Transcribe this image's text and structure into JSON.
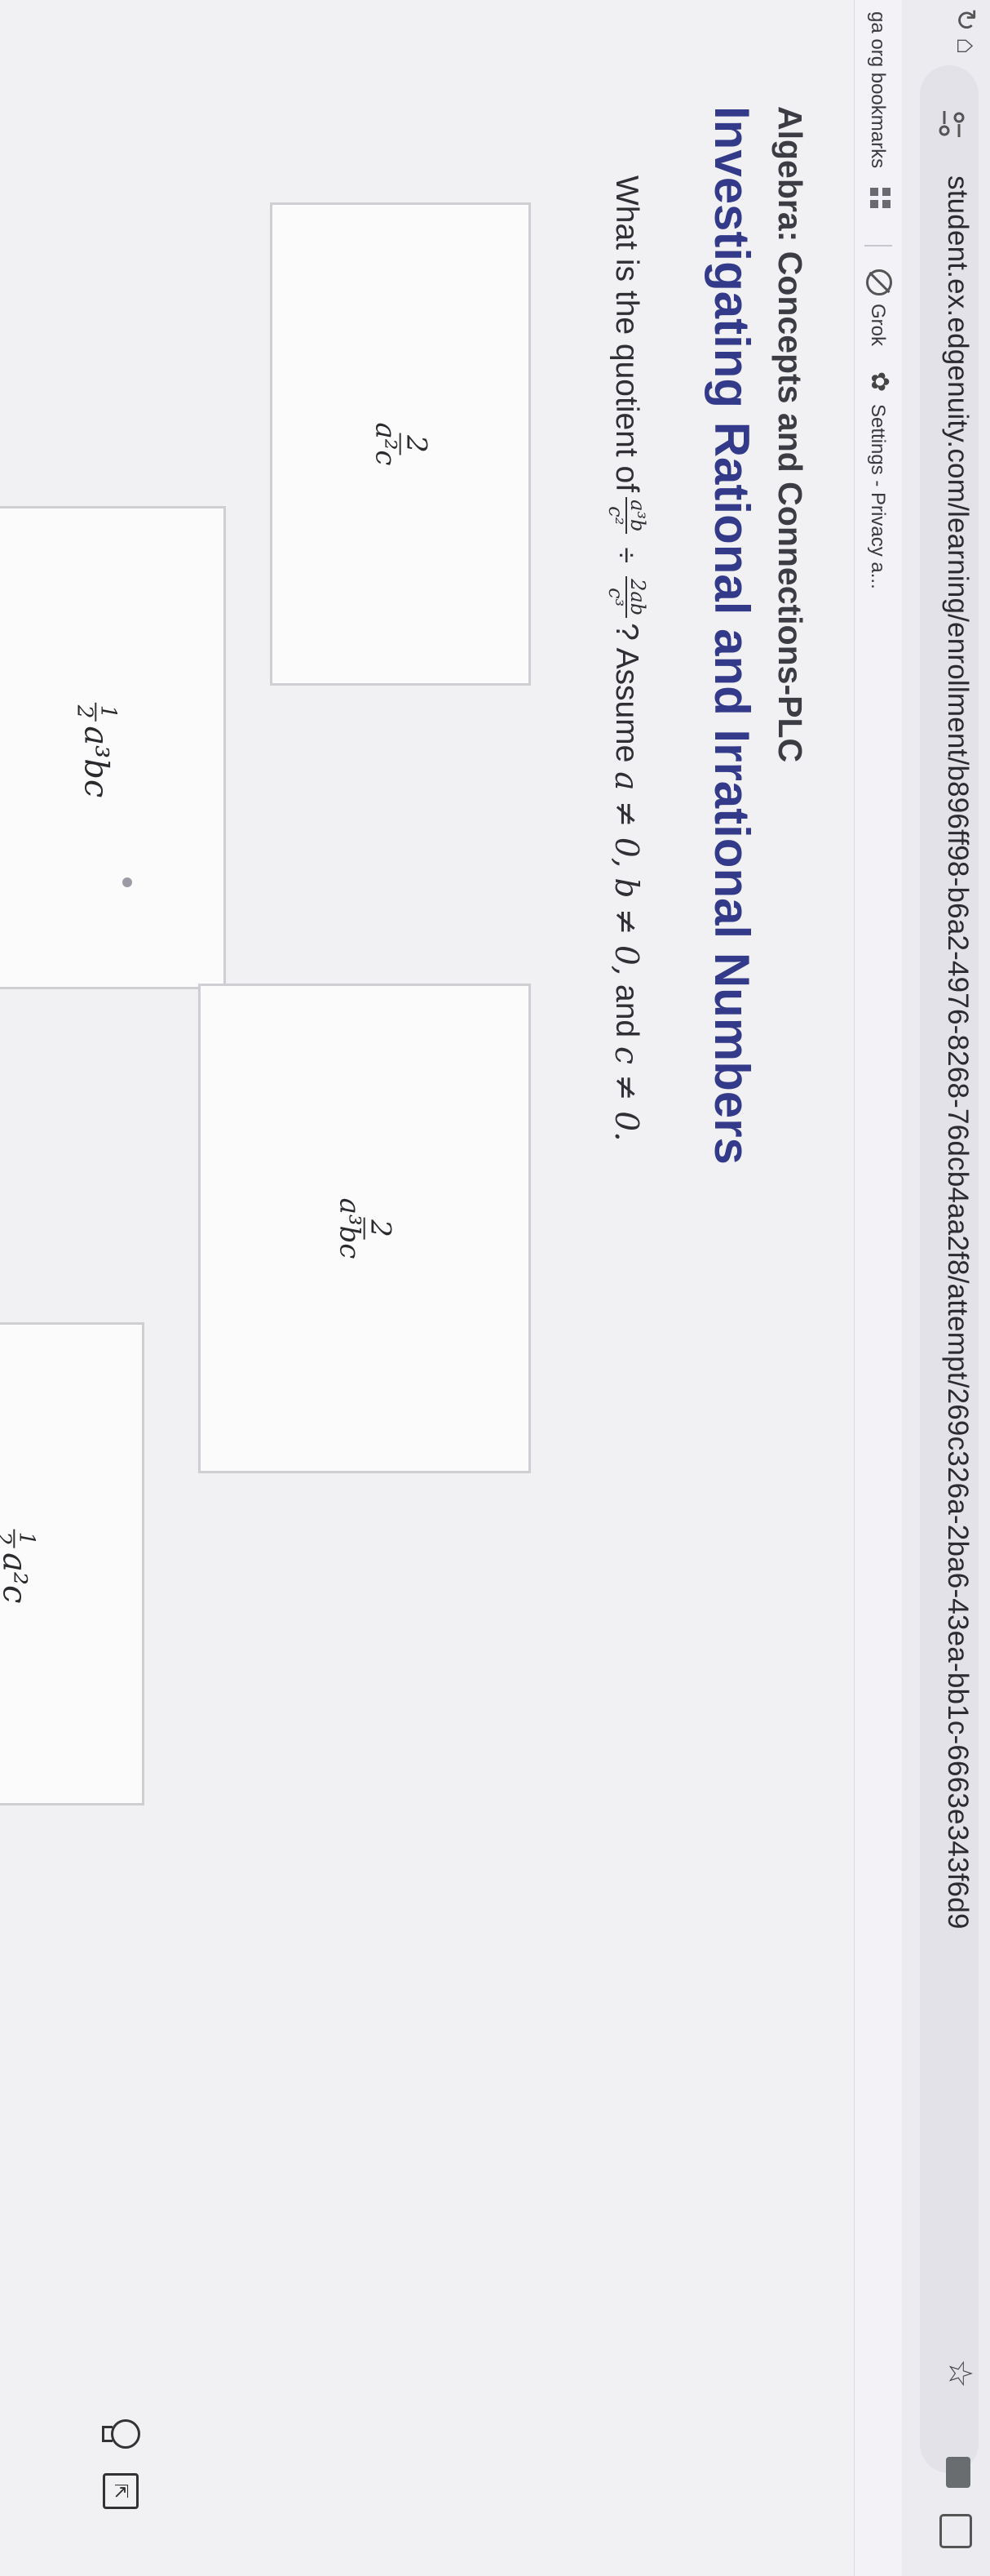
{
  "browser": {
    "url": "student.ex.edgenuity.com/learning/enrollment/b896ff98-b6a2-4976-8268-76dcb4aa2f8/attempt/269c326a-2ba6-43ea-bb1c-6663e343f6d9",
    "bookmarks": [
      {
        "label": "ga org bookmarks"
      },
      {
        "label": "Grok"
      },
      {
        "label": "Settings - Privacy a..."
      }
    ],
    "icons": [
      "reload-icon",
      "home-icon",
      "site-info-icon",
      "star-icon",
      "extension-icon",
      "side-panel-icon",
      "apps-icon",
      "grok-icon",
      "gear-icon"
    ]
  },
  "course": {
    "title": "Algebra: Concepts and Connections-PLC",
    "lesson": "Investigating Rational and Irrational Numbers"
  },
  "question": {
    "lead": "What is the quotient of",
    "f1_num": "a³b",
    "f1_den": "c²",
    "divide": "÷",
    "f2_num": "2ab",
    "f2_den": "c³",
    "tail_q": "? Assume",
    "cond_a": "a ≠ 0, b ≠ 0,",
    "and": "and",
    "cond_c": "c ≠ 0."
  },
  "choices": [
    {
      "num": "2",
      "den": "a²c"
    },
    {
      "coef_num": "1",
      "coef_den": "2",
      "term": "a³bc"
    },
    {
      "num": "2",
      "den": "a³bc"
    },
    {
      "coef_num": "1",
      "coef_den": "2",
      "term": "a²c"
    }
  ],
  "tools": {
    "icons": [
      "hint-icon",
      "tool-icon"
    ]
  }
}
